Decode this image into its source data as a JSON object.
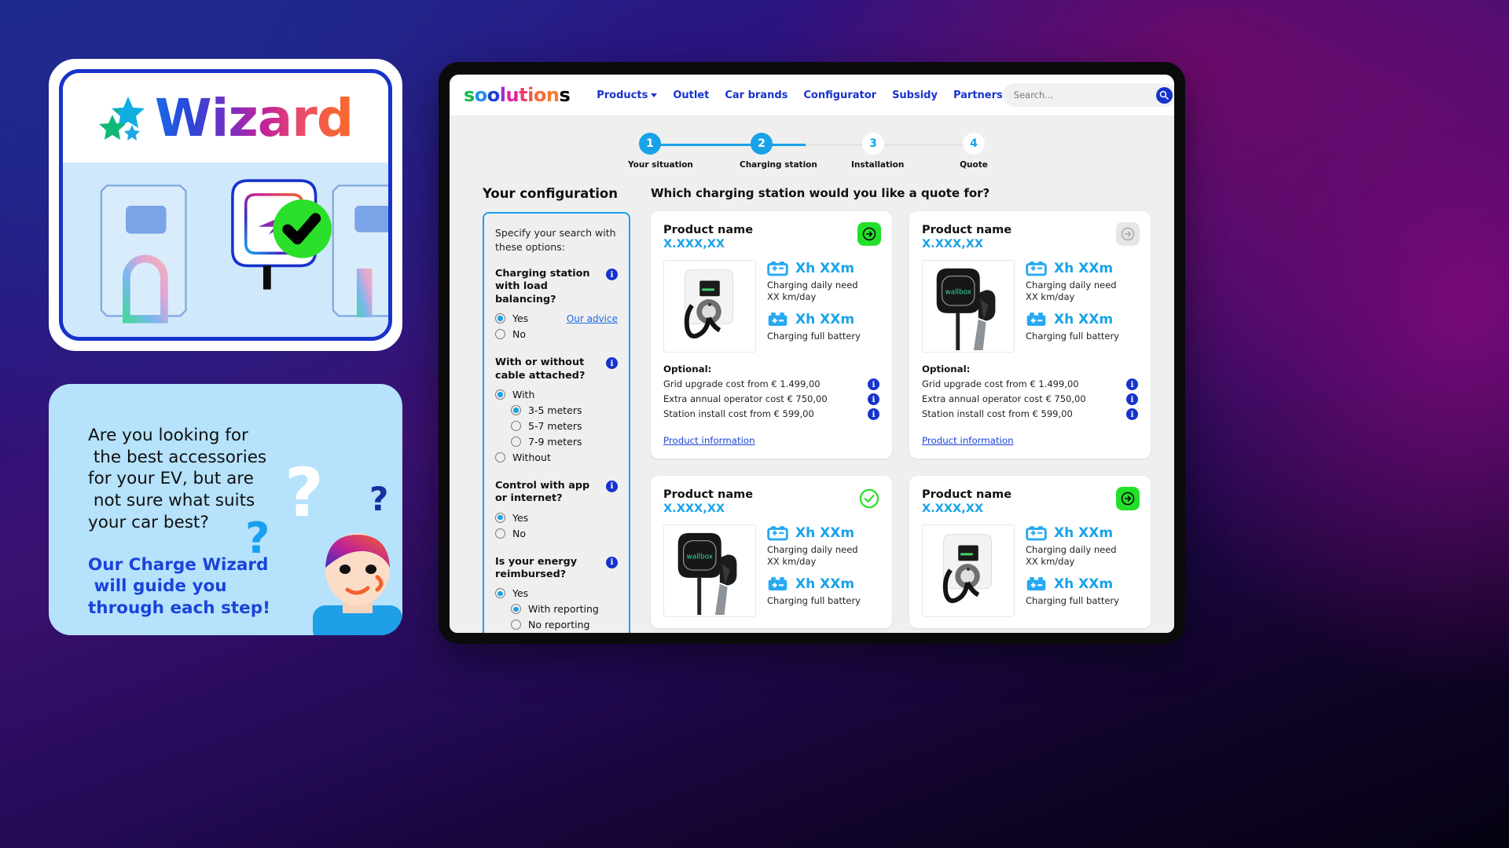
{
  "promo": {
    "wizard_word": "Wizard",
    "stars_icon": "sparkle-stars-icon",
    "illustration_alt": "charging-station-illustration",
    "question_lines": [
      "Are you looking for",
      " the best accessories",
      "for your EV, but are",
      " not sure what suits",
      "your car best?"
    ],
    "cta_lines": [
      "Our Charge Wizard",
      " will guide you",
      "through each step!"
    ],
    "accent_blue": "#1a44d8",
    "card_bg": "#b6e2fb"
  },
  "header": {
    "logo_letters": [
      "s",
      "o",
      "o",
      "l",
      "u",
      "t",
      "i",
      "o",
      "n",
      "s"
    ],
    "logo_text": "soolutions",
    "nav": [
      {
        "label": "Products",
        "has_dropdown": true
      },
      {
        "label": "Outlet",
        "has_dropdown": false
      },
      {
        "label": "Car brands",
        "has_dropdown": false
      },
      {
        "label": "Configurator",
        "has_dropdown": false
      },
      {
        "label": "Subsidy",
        "has_dropdown": false
      },
      {
        "label": "Partners",
        "has_dropdown": false
      }
    ],
    "search": {
      "placeholder": "Search...",
      "value": ""
    },
    "account_icon": "user-account-icon",
    "cart_icon": "shopping-cart-icon"
  },
  "stepper": {
    "steps": [
      {
        "number": "1",
        "label": "Your situation",
        "state": "active"
      },
      {
        "number": "2",
        "label": "Charging station",
        "state": "active"
      },
      {
        "number": "3",
        "label": "Installation",
        "state": "idle"
      },
      {
        "number": "4",
        "label": "Quote",
        "state": "idle"
      }
    ],
    "active_color": "#19a2e8",
    "inactive_color": "#e4e4e4"
  },
  "config": {
    "title": "Your configuration",
    "intro": "Specify your search with these options:",
    "advice_link": "Our advice",
    "groups": [
      {
        "question": "Charging station with load balancing?",
        "info_icon": "info-icon",
        "options": [
          {
            "label": "Yes",
            "selected": true,
            "sub": false
          },
          {
            "label": "No",
            "selected": false,
            "sub": false
          }
        ]
      },
      {
        "question": "With or without cable attached?",
        "info_icon": "info-icon",
        "options": [
          {
            "label": "With",
            "selected": true,
            "sub": false
          },
          {
            "label": "3-5 meters",
            "selected": true,
            "sub": true
          },
          {
            "label": "5-7 meters",
            "selected": false,
            "sub": true
          },
          {
            "label": "7-9 meters",
            "selected": false,
            "sub": true
          },
          {
            "label": "Without",
            "selected": false,
            "sub": false
          }
        ]
      },
      {
        "question": "Control with app or internet?",
        "info_icon": "info-icon",
        "options": [
          {
            "label": "Yes",
            "selected": true,
            "sub": false
          },
          {
            "label": "No",
            "selected": false,
            "sub": false
          }
        ]
      },
      {
        "question": "Is your energy reimbursed?",
        "info_icon": "info-icon",
        "options": [
          {
            "label": "Yes",
            "selected": true,
            "sub": false
          },
          {
            "label": "With reporting",
            "selected": true,
            "sub": true
          },
          {
            "label": "No reporting",
            "selected": false,
            "sub": true
          }
        ]
      }
    ]
  },
  "products": {
    "heading": "Which charging station would you like a quote for?",
    "labels": {
      "optional": "Optional:",
      "daily_need": "Charging daily need",
      "daily_need_sub": "XX km/day",
      "full_battery": "Charging full battery",
      "product_link": "Product information"
    },
    "items": [
      {
        "name": "Product name",
        "price": "X.XXX,XX",
        "action": "arrow",
        "action_icon": "arrow-right-circle-icon",
        "image": "white-wallbox-charger",
        "spec_daily": "Xh XXm",
        "spec_full": "Xh XXm",
        "optional_lines": [
          "Grid upgrade cost from € 1.499,00",
          "Extra annual operator cost € 750,00",
          "Station install cost from € 599,00"
        ],
        "link": "Product information"
      },
      {
        "name": "Product name",
        "price": "X.XXX,XX",
        "action": "arrow-disabled",
        "action_icon": "arrow-right-circle-icon",
        "image": "black-wallbox-charger",
        "spec_daily": "Xh XXm",
        "spec_full": "Xh XXm",
        "optional_lines": [
          "Grid upgrade cost from € 1.499,00",
          "Extra annual operator cost € 750,00",
          "Station install cost from € 599,00"
        ],
        "link": "Product information"
      },
      {
        "name": "Product name",
        "price": "X.XXX,XX",
        "action": "check",
        "action_icon": "check-circle-icon",
        "image": "black-wallbox-charger",
        "spec_daily": "Xh XXm",
        "spec_full": "Xh XXm",
        "optional_lines": [],
        "link": ""
      },
      {
        "name": "Product name",
        "price": "X.XXX,XX",
        "action": "arrow",
        "action_icon": "arrow-right-circle-icon",
        "image": "white-wallbox-charger",
        "spec_daily": "Xh XXm",
        "spec_full": "Xh XXm",
        "optional_lines": [],
        "link": ""
      }
    ]
  }
}
